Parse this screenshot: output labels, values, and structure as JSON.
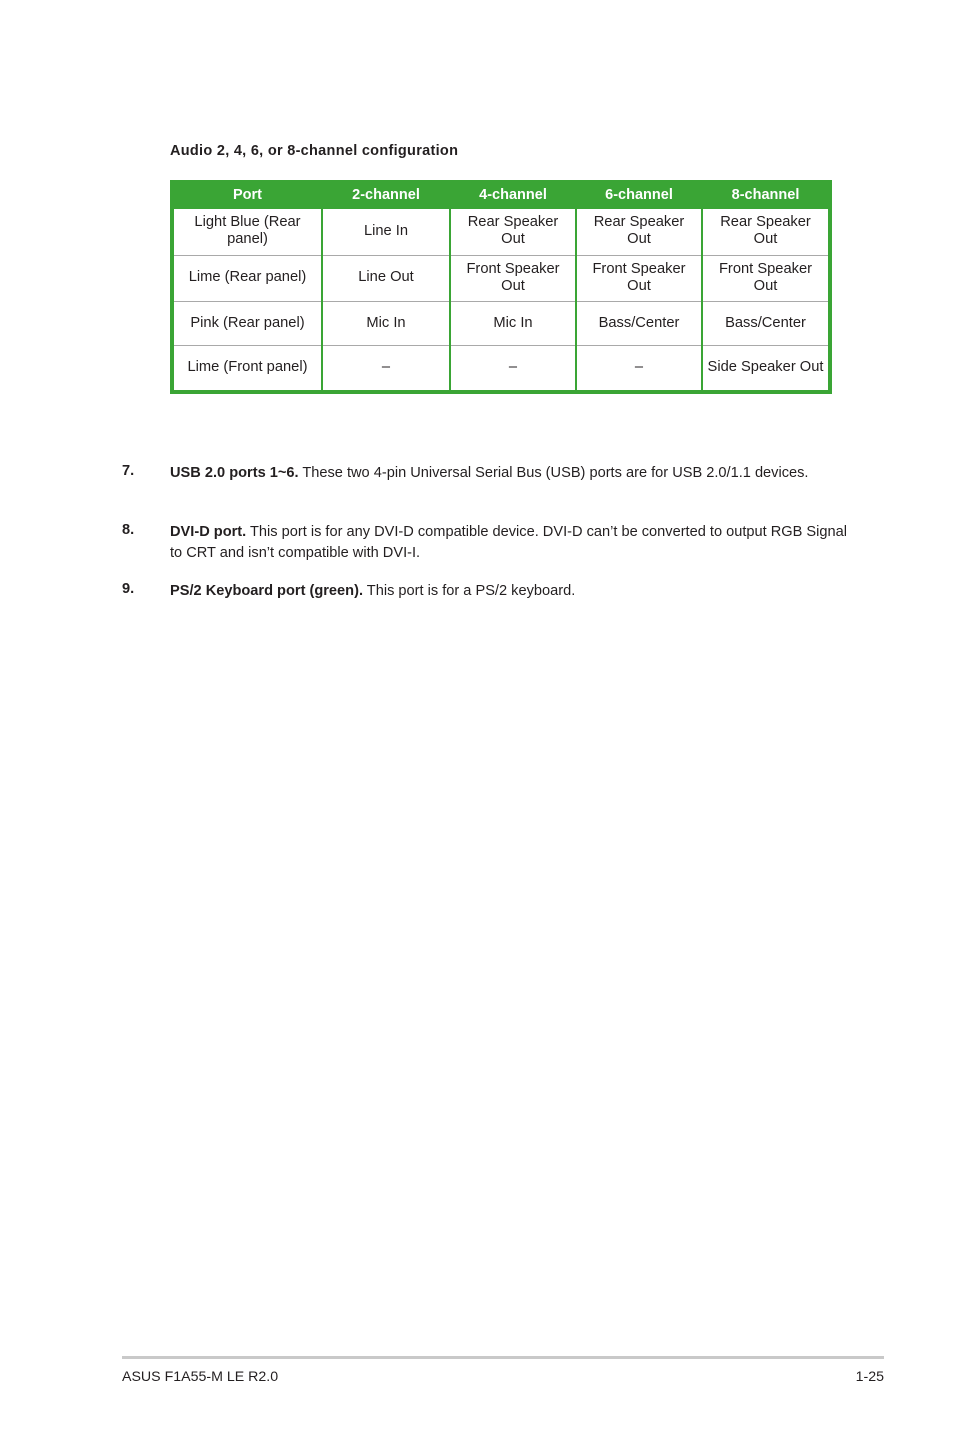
{
  "document": {
    "heading": "Audio 2, 4, 6, or 8-channel configuration"
  },
  "colors": {
    "table_accent_green": "#3aa535",
    "header_text": "#ffffff",
    "body_text": "#231f20",
    "row_divider_gray": "#a9a9a9",
    "footer_rule_gray": "#c9c9c9"
  },
  "table": {
    "headers": [
      "Port",
      "2-channel",
      "4-channel",
      "6-channel",
      "8-channel"
    ],
    "rows": [
      {
        "port": "Light Blue (Rear panel)",
        "ch2": "Line In",
        "ch4": "Rear Speaker Out",
        "ch6": "Rear Speaker Out",
        "ch8": "Rear Speaker Out"
      },
      {
        "port": "Lime (Rear panel)",
        "ch2": "Line Out",
        "ch4": "Front Speaker Out",
        "ch6": "Front Speaker Out",
        "ch8": "Front Speaker Out"
      },
      {
        "port": "Pink (Rear panel)",
        "ch2": "Mic In",
        "ch4": "Mic In",
        "ch6": "Bass/Center",
        "ch8": "Bass/Center"
      },
      {
        "port": "Lime (Front panel)",
        "ch2": "–",
        "ch4": "–",
        "ch6": "–",
        "ch8": "Side Speaker Out"
      }
    ]
  },
  "list_items": [
    {
      "number": "7.",
      "title": "USB 2.0 ports 1~6.",
      "text": " These two 4-pin Universal Serial Bus (USB) ports are for USB 2.0/1.1 devices."
    },
    {
      "number": "8.",
      "title": "DVI-D port.",
      "text": " This port is for any DVI-D compatible device. DVI-D can’t be converted to output RGB Signal to CRT and isn’t compatible with DVI-I."
    },
    {
      "number": "9.",
      "title": "PS/2 Keyboard port (green).",
      "text": " This port is for a PS/2 keyboard."
    }
  ],
  "footer": {
    "left": "ASUS F1A55-M LE R2.0",
    "page_number": "1-25"
  }
}
